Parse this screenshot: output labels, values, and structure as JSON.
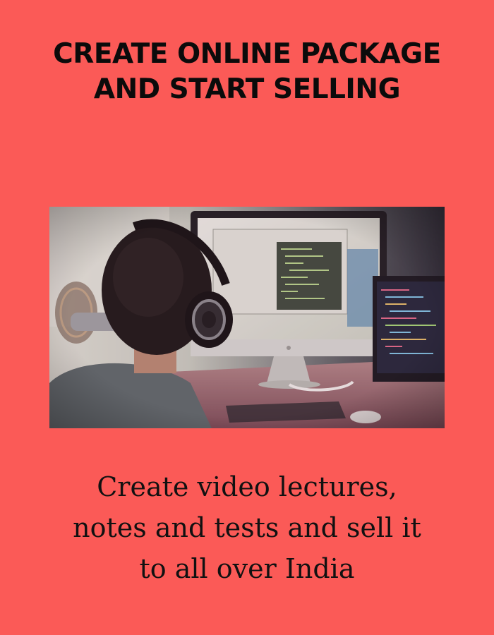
{
  "headline": {
    "line1": "CREATE ONLINE PACKAGE",
    "line2": "AND START SELLING"
  },
  "tagline": {
    "line1": "Create video lectures,",
    "line2": "notes and tests and sell it",
    "line3": "to all over India"
  },
  "colors": {
    "background": "#fb5a57",
    "headline_text": "#0b0b0b",
    "tagline_text": "#111111"
  }
}
